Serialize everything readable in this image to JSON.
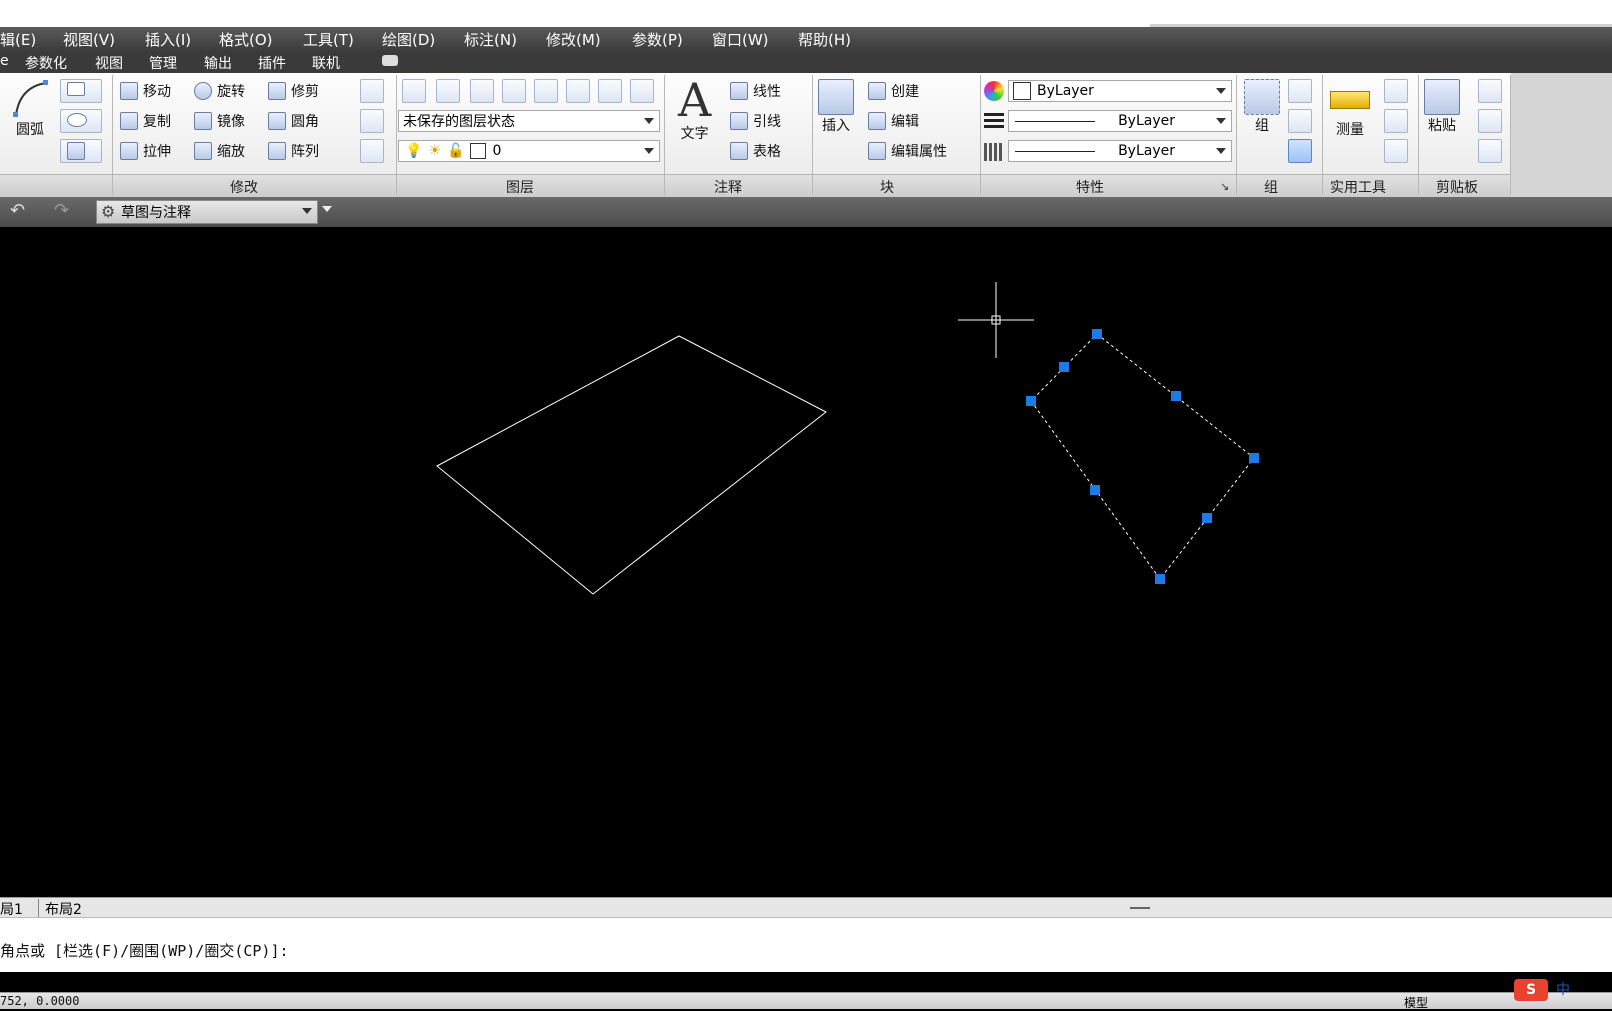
{
  "menu": {
    "items": [
      "辑(E)",
      "视图(V)",
      "插入(I)",
      "格式(O)",
      "工具(T)",
      "绘图(D)",
      "标注(N)",
      "修改(M)",
      "参数(P)",
      "窗口(W)",
      "帮助(H)"
    ]
  },
  "tabs": {
    "items": [
      "e",
      "参数化",
      "视图",
      "管理",
      "输出",
      "插件",
      "联机"
    ]
  },
  "ribbon": {
    "draw": {
      "arc_label": "圆弧"
    },
    "modify": {
      "title": "修改",
      "move": "移动",
      "rotate": "旋转",
      "trim": "修剪",
      "copy": "复制",
      "mirror": "镜像",
      "fillet": "圆角",
      "stretch": "拉伸",
      "scale": "缩放",
      "array": "阵列"
    },
    "layers": {
      "title": "图层",
      "state": "未保存的图层状态",
      "current_layer": "0"
    },
    "annotation": {
      "title": "注释",
      "text": "文字",
      "linear": "线性",
      "leader": "引线",
      "table": "表格"
    },
    "block": {
      "title": "块",
      "insert": "插入",
      "create": "创建",
      "edit": "编辑",
      "edit_attr": "编辑属性"
    },
    "properties": {
      "title": "特性",
      "color": "ByLayer",
      "linetype": "ByLayer",
      "lineweight": "ByLayer"
    },
    "group": {
      "title": "组",
      "group_label": "组"
    },
    "utilities": {
      "title": "实用工具",
      "measure": "测量"
    },
    "clipboard": {
      "title": "剪贴板",
      "paste": "粘贴"
    }
  },
  "quick_access": {
    "workspace": "草图与注释"
  },
  "layout_tabs": {
    "items": [
      "局1",
      "布局2"
    ]
  },
  "command_line": {
    "prompt": "角点或 [栏选(F)/圈围(WP)/圈交(CP)]:"
  },
  "status": {
    "coords": "752, 0.0000",
    "model": "模型"
  },
  "ime": {
    "label": "中"
  }
}
